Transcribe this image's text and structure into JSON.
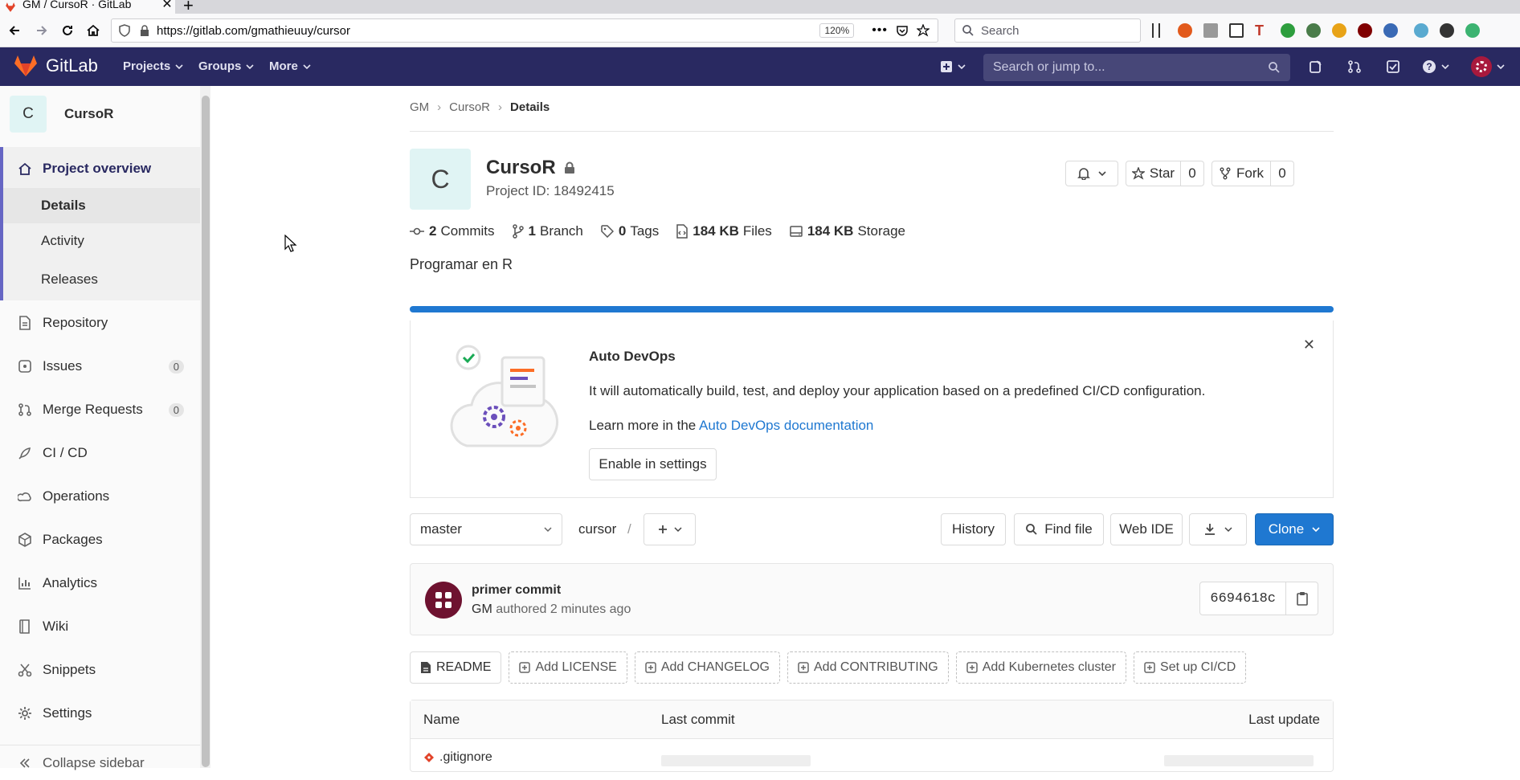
{
  "browser": {
    "tab_title": "GM / CursoR · GitLab",
    "url": "https://gitlab.com/gmathieuuy/cursor",
    "zoom": "120%",
    "search_placeholder": "Search"
  },
  "header": {
    "brand": "GitLab",
    "menus": [
      "Projects",
      "Groups",
      "More"
    ],
    "search_placeholder": "Search or jump to..."
  },
  "sidebar": {
    "project_initial": "C",
    "project_name": "CursoR",
    "overview": "Project overview",
    "sub_items": [
      "Details",
      "Activity",
      "Releases"
    ],
    "items": [
      {
        "label": "Repository",
        "count": ""
      },
      {
        "label": "Issues",
        "count": "0"
      },
      {
        "label": "Merge Requests",
        "count": "0"
      },
      {
        "label": "CI / CD",
        "count": ""
      },
      {
        "label": "Operations",
        "count": ""
      },
      {
        "label": "Packages",
        "count": ""
      },
      {
        "label": "Analytics",
        "count": ""
      },
      {
        "label": "Wiki",
        "count": ""
      },
      {
        "label": "Snippets",
        "count": ""
      },
      {
        "label": "Settings",
        "count": ""
      }
    ],
    "collapse": "Collapse sidebar"
  },
  "breadcrumb": [
    "GM",
    "CursoR",
    "Details"
  ],
  "project": {
    "initial": "C",
    "name": "CursoR",
    "id_label": "Project ID: 18492415",
    "star_label": "Star",
    "star_count": "0",
    "fork_label": "Fork",
    "fork_count": "0",
    "description": "Programar en R"
  },
  "stats": [
    {
      "value": "2",
      "label": "Commits"
    },
    {
      "value": "1",
      "label": "Branch"
    },
    {
      "value": "0",
      "label": "Tags"
    },
    {
      "value": "184 KB",
      "label": "Files"
    },
    {
      "value": "184 KB",
      "label": "Storage"
    }
  ],
  "progress_fraction": 1.0,
  "devops": {
    "title": "Auto DevOps",
    "text": "It will automatically build, test, and deploy your application based on a predefined CI/CD configuration.",
    "learn_prefix": "Learn more in the ",
    "learn_link": "Auto DevOps documentation",
    "enable_button": "Enable in settings"
  },
  "repo_toolbar": {
    "branch": "master",
    "path": "cursor",
    "path_sep": "/",
    "history": "History",
    "find_file": "Find file",
    "web_ide": "Web IDE",
    "clone": "Clone"
  },
  "last_commit": {
    "title": "primer commit",
    "author": "GM",
    "meta": "authored 2 minutes ago",
    "sha": "6694618c"
  },
  "quick_actions": [
    "README",
    "Add LICENSE",
    "Add CHANGELOG",
    "Add CONTRIBUTING",
    "Add Kubernetes cluster",
    "Set up CI/CD"
  ],
  "file_table": {
    "headers": [
      "Name",
      "Last commit",
      "Last update"
    ],
    "rows": [
      {
        "name": ".gitignore"
      }
    ]
  },
  "colors": {
    "header_bg": "#292961",
    "accent_blue": "#1f78d1",
    "sidebar_active": "#6666c4"
  }
}
